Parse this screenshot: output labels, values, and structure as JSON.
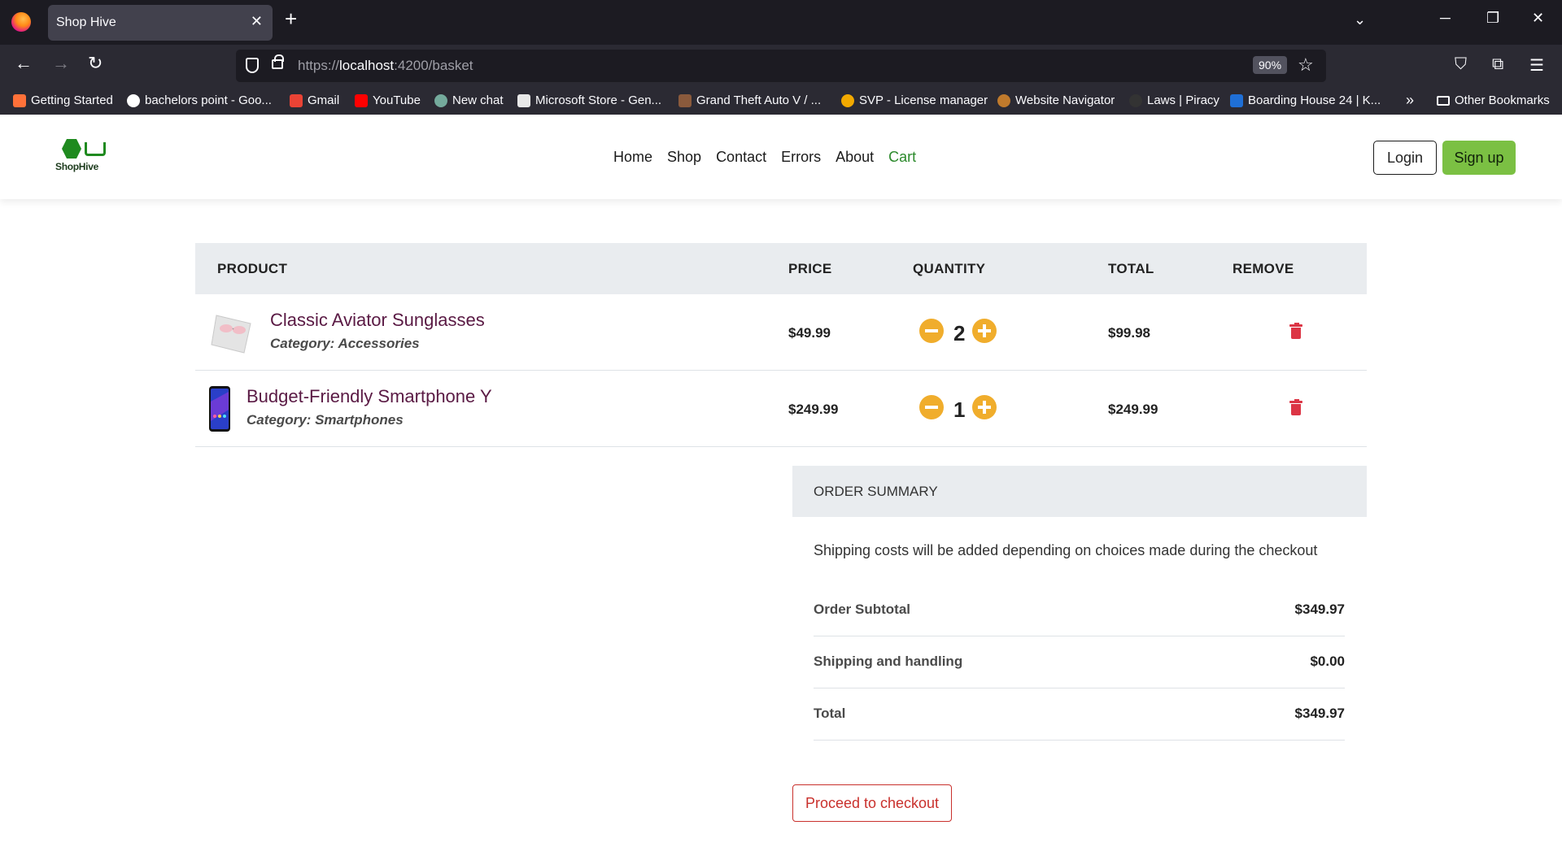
{
  "browser": {
    "tab_title": "Shop Hive",
    "url_prefix": "https://",
    "url_host": "localhost",
    "url_path": ":4200/basket",
    "zoom": "90%",
    "bookmarks": [
      {
        "label": "Getting Started",
        "color": "#ff7139"
      },
      {
        "label": "bachelors point - Goo...",
        "color": "#ffffff"
      },
      {
        "label": "Gmail",
        "color": "#ea4335"
      },
      {
        "label": "YouTube",
        "color": "#ff0000"
      },
      {
        "label": "New chat",
        "color": "#74aa9c"
      },
      {
        "label": "Microsoft Store - Gen...",
        "color": "#e8e8e8"
      },
      {
        "label": "Grand Theft Auto V / ...",
        "color": "#8a5a3c"
      },
      {
        "label": "SVP - License manager",
        "color": "#f2a900"
      },
      {
        "label": "Website Navigator",
        "color": "#c07a2c"
      },
      {
        "label": "Laws | Piracy",
        "color": "#333333"
      },
      {
        "label": "Boarding House 24 | K...",
        "color": "#1f6fd6"
      }
    ],
    "other_bookmarks": "Other Bookmarks"
  },
  "site": {
    "logo_text": "ShopHive",
    "nav": [
      "Home",
      "Shop",
      "Contact",
      "Errors",
      "About",
      "Cart"
    ],
    "login_label": "Login",
    "signup_label": "Sign up",
    "accent": "#7bc043"
  },
  "cart": {
    "headers": {
      "product": "PRODUCT",
      "price": "PRICE",
      "quantity": "QUANTITY",
      "total": "TOTAL",
      "remove": "REMOVE"
    },
    "items": [
      {
        "name": "Classic Aviator Sunglasses",
        "category": "Category: Accessories",
        "price": "$49.99",
        "quantity": "2",
        "total": "$99.98"
      },
      {
        "name": "Budget-Friendly Smartphone Y",
        "category": "Category: Smartphones",
        "price": "$249.99",
        "quantity": "1",
        "total": "$249.99"
      }
    ]
  },
  "summary": {
    "title": "ORDER SUMMARY",
    "note": "Shipping costs will be added depending on choices made during the checkout",
    "rows": [
      {
        "label": "Order Subtotal",
        "value": "$349.97"
      },
      {
        "label": "Shipping and handling",
        "value": "$0.00"
      },
      {
        "label": "Total",
        "value": "$349.97"
      }
    ],
    "checkout_label": "Proceed to checkout"
  }
}
